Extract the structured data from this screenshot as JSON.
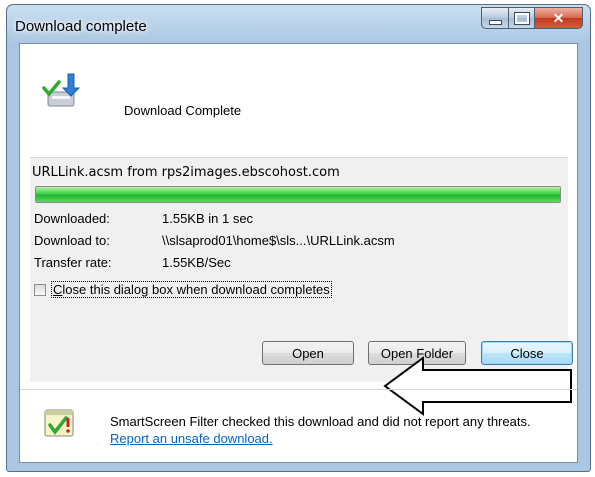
{
  "window": {
    "title": "Download complete"
  },
  "header": {
    "text": "Download Complete",
    "icon": "download-complete-icon"
  },
  "download": {
    "filename_source": "URLLink.acsm from rps2images.ebscohost.com",
    "progress_fraction": 1.0,
    "rows": [
      {
        "label": "Downloaded:",
        "value": "1.55KB in 1 sec"
      },
      {
        "label": "Download to:",
        "value": "\\\\slsaprod01\\home$\\sls...\\URLLink.acsm"
      },
      {
        "label": "Transfer rate:",
        "value": "1.55KB/Sec"
      }
    ]
  },
  "options": {
    "close_when_done_label": "Close this dialog box when download completes",
    "close_when_done_checked": false
  },
  "buttons": {
    "open": "Open",
    "open_folder": "Open Folder",
    "close": "Close"
  },
  "smartscreen": {
    "text": "SmartScreen Filter checked this download and did not report any threats.",
    "link": "Report an unsafe download."
  },
  "colors": {
    "progress": "#2fc63b",
    "link": "#0066cc",
    "frame": "#a9c6e2"
  }
}
